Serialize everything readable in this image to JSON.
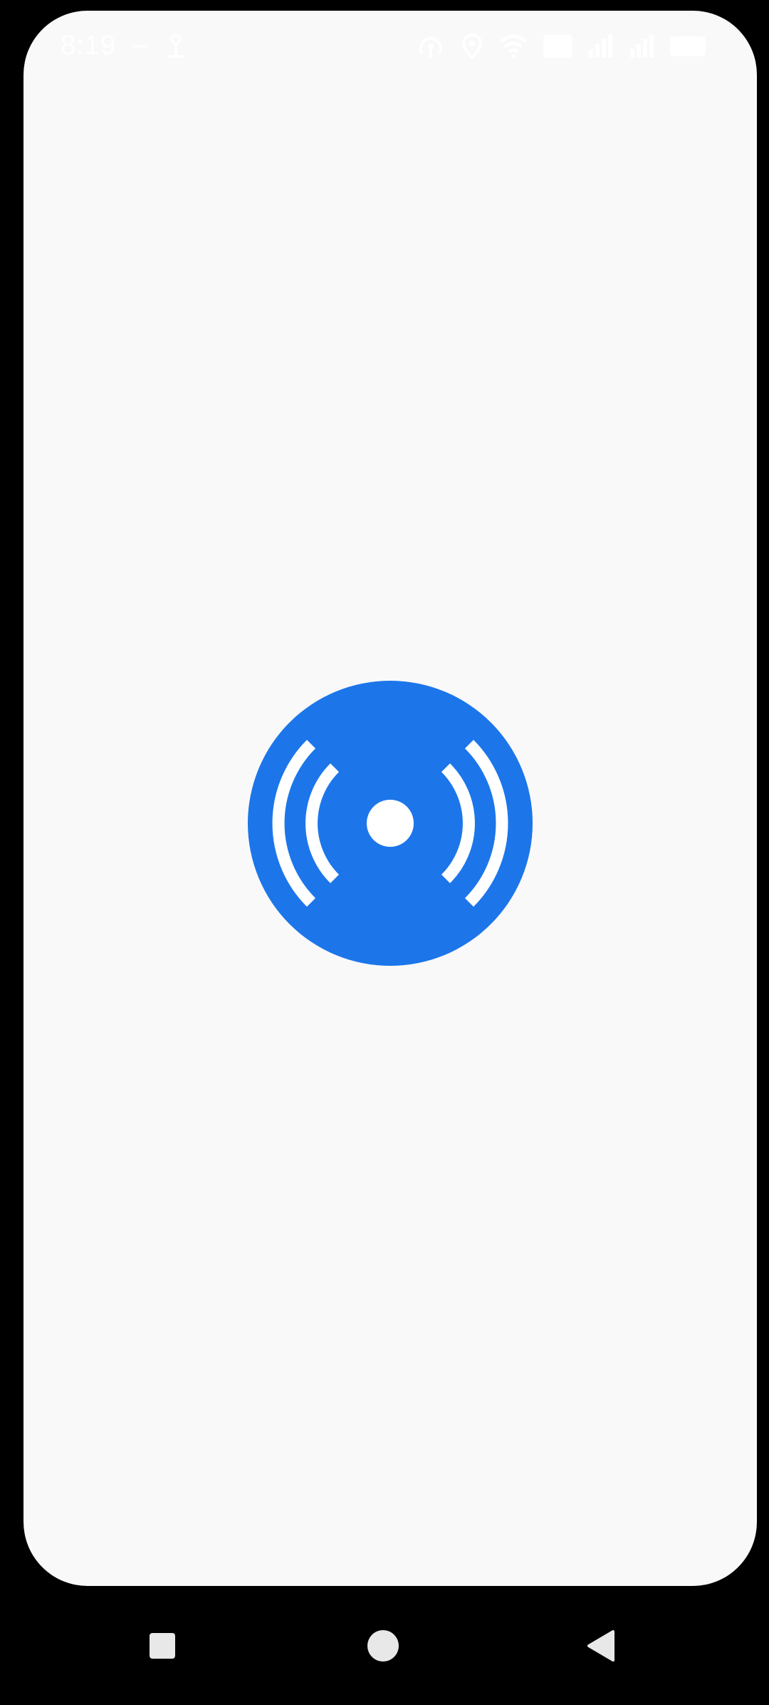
{
  "status_bar": {
    "time": "8:19",
    "icons": [
      "dot-icon",
      "key-icon",
      "hotspot-icon",
      "location-icon",
      "wifi-icon",
      "volte-icon",
      "signal-icon",
      "signal-icon-2",
      "battery-icon"
    ]
  },
  "splash": {
    "logo_icon": "broadcast-signal-icon",
    "logo_color": "#1c76ea",
    "background": "#f9f9f9"
  },
  "nav_bar": {
    "buttons": [
      "recent-apps",
      "home",
      "back"
    ]
  }
}
